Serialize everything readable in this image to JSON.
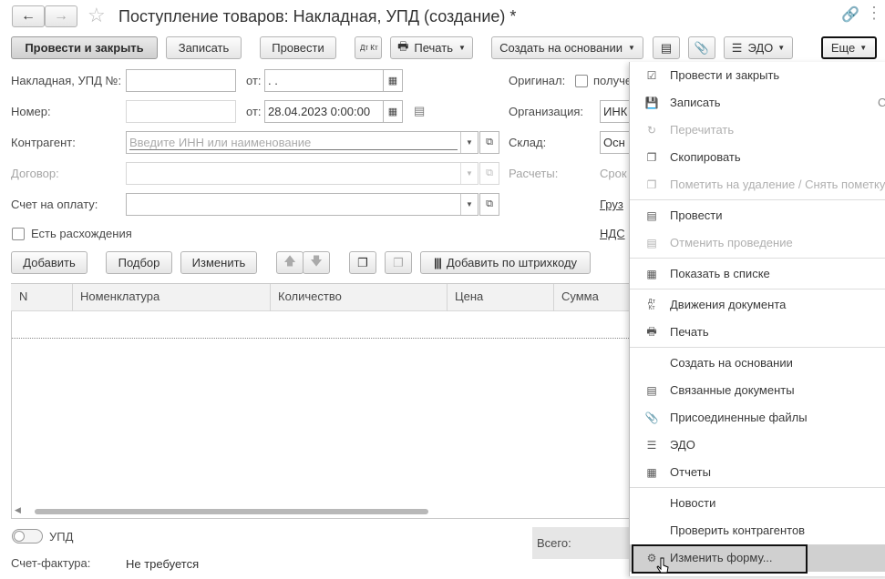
{
  "window": {
    "title": "Поступление товаров: Накладная, УПД (создание) *"
  },
  "toolbar": {
    "post_close": "Провести и закрыть",
    "save": "Записать",
    "post": "Провести",
    "dtkt": "Дт Кт",
    "print": "Печать",
    "create_based": "Создать на основании",
    "edo": "ЭДО",
    "more": "Еще"
  },
  "form": {
    "invoice_label": "Накладная, УПД №:",
    "invoice_value": "",
    "from_label": "от:",
    "invoice_date": "  .  .",
    "number_label": "Номер:",
    "number_value": "",
    "date_value": "28.04.2023  0:00:00",
    "counterparty_label": "Контрагент:",
    "counterparty_placeholder": "Введите ИНН или наименование",
    "contract_label": "Договор:",
    "bill_label": "Счет на оплату:",
    "discrepancies_label": "Есть расхождения",
    "original_label": "Оригинал:",
    "original_value": "получе",
    "org_label": "Организация:",
    "org_value": "ИНК",
    "warehouse_label": "Склад:",
    "warehouse_value": "Осн",
    "settlements_label": "Расчеты:",
    "settlements_value": "Срок",
    "shipper_link": "Груз",
    "vat_link": "НДС"
  },
  "table_toolbar": {
    "add": "Добавить",
    "select": "Подбор",
    "change": "Изменить",
    "barcode": "Добавить по штрихкоду"
  },
  "grid": {
    "columns": [
      "N",
      "Номенклатура",
      "Количество",
      "Цена",
      "Сумма"
    ]
  },
  "footer": {
    "upd_label": "УПД",
    "invoice_label": "Счет-фактура:",
    "invoice_value": "Не требуется",
    "total_label": "Всего:"
  },
  "menu": {
    "items": [
      {
        "label": "Провести и закрыть",
        "icon": "post-close-icon",
        "disabled": false
      },
      {
        "label": "Записать",
        "icon": "save-icon",
        "disabled": false,
        "shortcut": "C"
      },
      {
        "label": "Перечитать",
        "icon": "reload-icon",
        "disabled": true
      },
      {
        "label": "Скопировать",
        "icon": "copy-icon",
        "disabled": false
      },
      {
        "label": "Пометить на удаление / Снять пометку",
        "icon": "delete-mark-icon",
        "disabled": true
      },
      {
        "label": "Провести",
        "icon": "post-icon",
        "disabled": false
      },
      {
        "label": "Отменить проведение",
        "icon": "unpost-icon",
        "disabled": true
      },
      {
        "label": "Показать в списке",
        "icon": "list-icon",
        "disabled": false
      },
      {
        "label": "Движения документа",
        "icon": "dtkt-icon",
        "disabled": false
      },
      {
        "label": "Печать",
        "icon": "printer-icon",
        "disabled": false
      },
      {
        "label": "Создать на основании",
        "icon": "",
        "disabled": false
      },
      {
        "label": "Связанные документы",
        "icon": "related-docs-icon",
        "disabled": false
      },
      {
        "label": "Присоединенные файлы",
        "icon": "paperclip-icon",
        "disabled": false
      },
      {
        "label": "ЭДО",
        "icon": "edo-icon",
        "disabled": false
      },
      {
        "label": "Отчеты",
        "icon": "reports-icon",
        "disabled": false
      },
      {
        "label": "Новости",
        "icon": "",
        "disabled": false
      },
      {
        "label": "Проверить контрагентов",
        "icon": "",
        "disabled": false
      },
      {
        "label": "Изменить форму...",
        "icon": "form-settings-icon",
        "disabled": false,
        "highlighted": true
      }
    ]
  }
}
